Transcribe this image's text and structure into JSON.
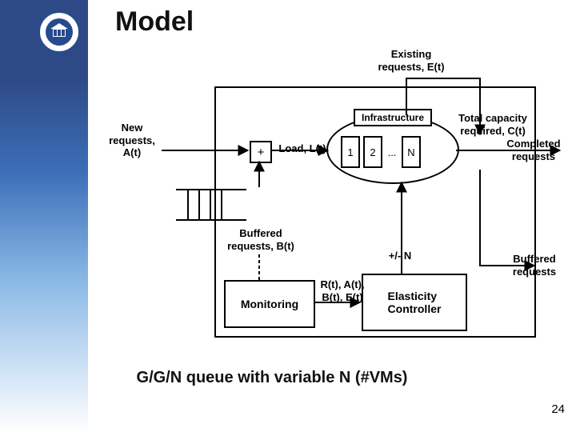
{
  "title": "Model",
  "caption": "G/G/N queue with variable N (#VMs)",
  "page_number": "24",
  "labels": {
    "new_requests": "New\nrequests,\nA(t)",
    "existing_requests": "Existing\nrequests, E(t)",
    "total_capacity": "Total capacity\nrequired, C(t)",
    "completed_requests": "Completed\nrequests",
    "load": "Load, L(t)",
    "plus": "+",
    "buffered_left": "Buffered\nrequests, B(t)",
    "buffered_right": "Buffered\nrequests",
    "plus_minus_n": "+/- N",
    "metrics": "R(t), A(t),\nB(t), E(t)"
  },
  "blocks": {
    "infrastructure": "Infrastructure",
    "monitoring": "Monitoring",
    "elasticity_controller": "Elasticity\nController",
    "vm1": "1",
    "vm2": "2",
    "vm_dots": "...",
    "vmN": "N"
  }
}
